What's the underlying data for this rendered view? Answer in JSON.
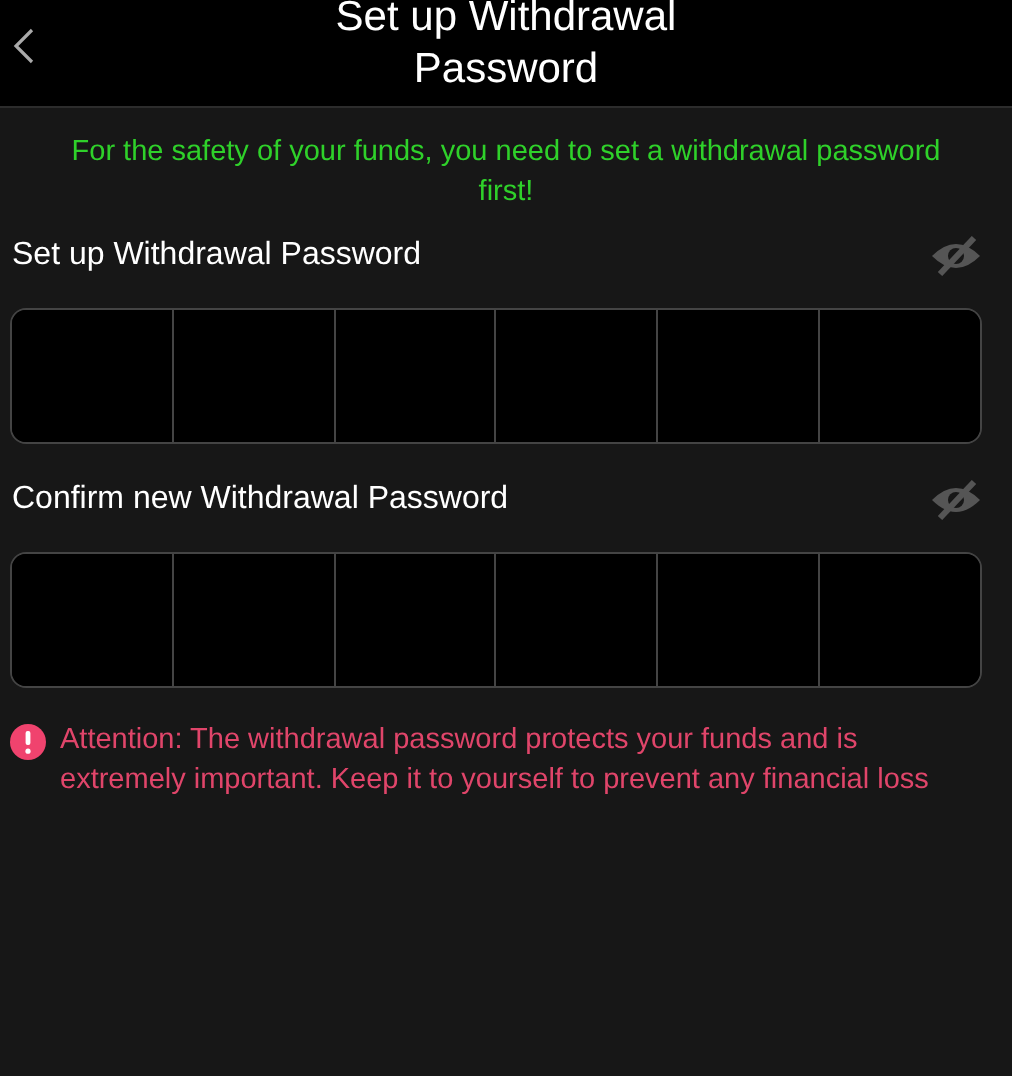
{
  "header": {
    "title": "Set up Withdrawal Password"
  },
  "notice": "For the safety of your funds, you need to set a withdrawal password first!",
  "fields": [
    {
      "label": "Set up Withdrawal Password",
      "masked": true
    },
    {
      "label": "Confirm new Withdrawal Password",
      "masked": true
    }
  ],
  "attention": "Attention: The withdrawal password protects your funds and is extremely important. Keep it to yourself to prevent any financial loss"
}
